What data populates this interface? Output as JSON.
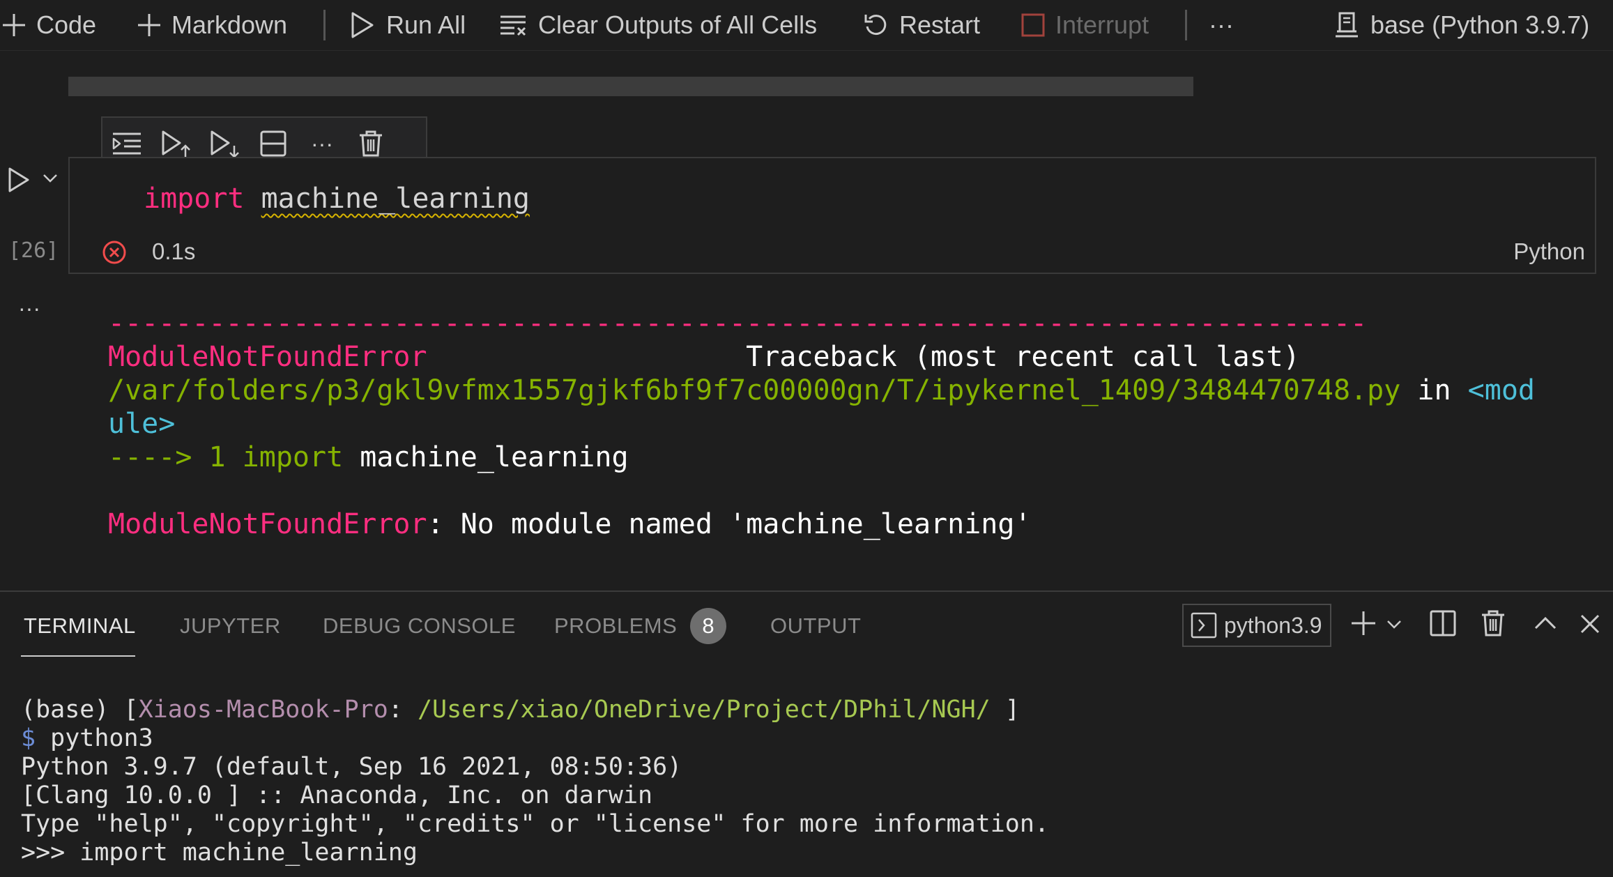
{
  "toolbar": {
    "code_label": "Code",
    "markdown_label": "Markdown",
    "run_all_label": "Run All",
    "clear_outputs_label": "Clear Outputs of All Cells",
    "restart_label": "Restart",
    "interrupt_label": "Interrupt",
    "more_label": "···",
    "kernel_label": "base (Python 3.9.7)"
  },
  "cell": {
    "code_keyword": "import",
    "code_module": "machine_learning",
    "execution_count": "[26]",
    "duration": "0.1s",
    "language": "Python",
    "more_label": "···"
  },
  "output": {
    "dash_line": "---------------------------------------------------------------------------",
    "error_name": "ModuleNotFoundError",
    "traceback_header": "Traceback (most recent call last)",
    "file_path": "/var/folders/p3/gkl9vfmx1557gjkf6bf9f7c00000gn/T/ipykernel_1409/3484470748.py",
    "in_word": " in ",
    "module_part1": "<mod",
    "module_part2": "ule>",
    "arrow": "----> 1 ",
    "arrow_import": "import",
    "arrow_module": " machine_learning",
    "error_name_2": "ModuleNotFoundError",
    "error_message": ": No module named 'machine_learning'"
  },
  "panel": {
    "tabs": [
      {
        "label": "TERMINAL"
      },
      {
        "label": "JUPYTER"
      },
      {
        "label": "DEBUG CONSOLE"
      },
      {
        "label": "PROBLEMS"
      },
      {
        "label": "OUTPUT"
      }
    ],
    "problems_count": "8",
    "terminal_selector": "python3.9"
  },
  "terminal": {
    "line1_prefix": "(base) [",
    "line1_host": "Xiaos-MacBook-Pro",
    "line1_colon": ": ",
    "line1_path": "/Users/xiao/OneDrive/Project/DPhil/NGH/",
    "line1_suffix": " ]",
    "line2_dollar": "$",
    "line2_cmd": " python3",
    "line3": "Python 3.9.7 (default, Sep 16 2021, 08:50:36)",
    "line4": "[Clang 10.0.0 ] :: Anaconda, Inc. on darwin",
    "line5": "Type \"help\", \"copyright\", \"credits\" or \"license\" for more information.",
    "line6": ">>> import machine_learning"
  },
  "colors": {
    "background": "#1e1e1e",
    "keyword": "#ff2e80",
    "path_green": "#86b300",
    "cyan": "#4ec0d9",
    "error_icon": "#f14c4c",
    "interrupt_icon": "#a1423c"
  }
}
